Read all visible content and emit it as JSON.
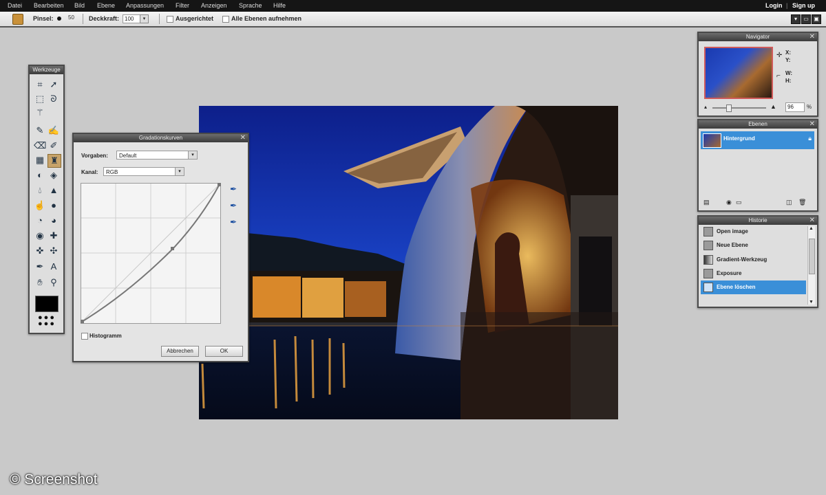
{
  "menu": {
    "items": [
      "Datei",
      "Bearbeiten",
      "Bild",
      "Ebene",
      "Anpassungen",
      "Filter",
      "Anzeigen",
      "Sprache",
      "Hilfe"
    ],
    "login": "Login",
    "separator": "|",
    "signup": "Sign up"
  },
  "toolbar": {
    "brush_label": "Pinsel:",
    "brush_size": "50",
    "opacity_label": "Deckkraft:",
    "opacity_value": "100",
    "aligned_label": "Ausgerichtet",
    "all_layers_label": "Alle Ebenen aufnehmen"
  },
  "tools_panel": {
    "title": "Werkzeuge",
    "icons": [
      "crop-icon",
      "move-icon",
      "marquee-icon",
      "lasso-icon",
      "magic-wand-icon",
      "pencil-icon",
      "brush-icon",
      "eraser-icon",
      "replace-color-icon",
      "gradient-icon",
      "clone-stamp-icon",
      "color-replace-icon",
      "paint-bucket-icon",
      "blur-icon",
      "sharpen-icon",
      "smudge-icon",
      "sponge-icon",
      "dodge-icon",
      "burn-icon",
      "red-eye-icon",
      "spot-heal-icon",
      "bloat-icon",
      "pinch-icon",
      "color-picker-icon",
      "type-icon",
      "hand-icon",
      "zoom-icon"
    ]
  },
  "curves_dialog": {
    "title": "Gradationskurven",
    "preset_label": "Vorgaben:",
    "preset_value": "Default",
    "channel_label": "Kanal:",
    "channel_value": "RGB",
    "histogram_label": "Histogramm",
    "cancel_label": "Abbrechen",
    "ok_label": "OK"
  },
  "navigator": {
    "title": "Navigator",
    "x_label": "X:",
    "y_label": "Y:",
    "w_label": "W:",
    "h_label": "H:",
    "zoom_value": "96",
    "zoom_unit": "%"
  },
  "layers": {
    "title": "Ebenen",
    "items": [
      {
        "name": "Hintergrund"
      }
    ]
  },
  "history": {
    "title": "Historie",
    "items": [
      "Open image",
      "Neue Ebene",
      "Gradient-Werkzeug",
      "Exposure",
      "Ebene löschen"
    ]
  },
  "watermark": "© Screenshot",
  "colors": {
    "accent": "#3a8fd8",
    "panel_bg": "#dedede",
    "menubar_bg": "#151515"
  }
}
